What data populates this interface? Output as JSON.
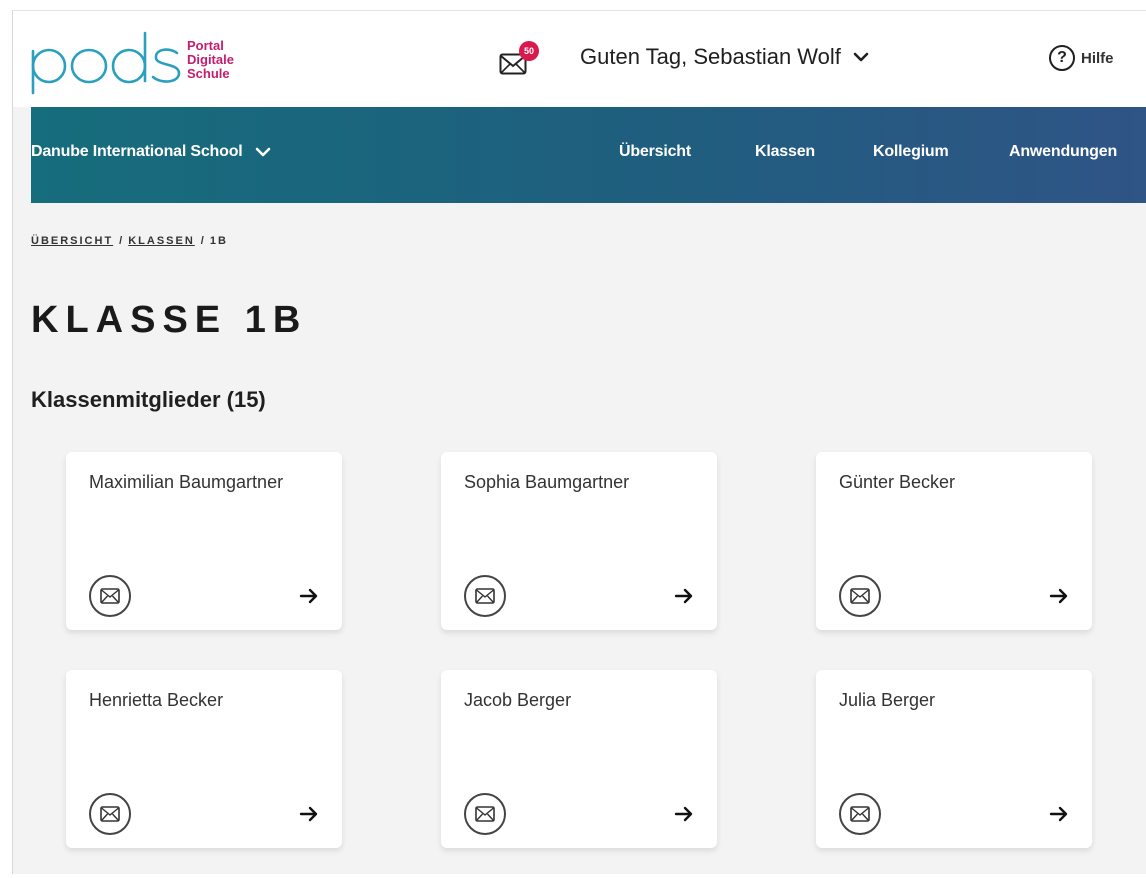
{
  "header": {
    "logo_word": "pods",
    "logo_sub": [
      "Portal",
      "Digitale",
      "Schule"
    ],
    "mail_badge": "50",
    "greeting": "Guten Tag, Sebastian Wolf",
    "help_label": "Hilfe",
    "help_symbol": "?"
  },
  "nav": {
    "school": "Danube International School",
    "links": [
      "Übersicht",
      "Klassen",
      "Kollegium",
      "Anwendungen"
    ]
  },
  "breadcrumb": {
    "items": [
      "ÜBERSICHT",
      "KLASSEN",
      "1B"
    ],
    "separator": "/"
  },
  "page": {
    "title": "KLASSE 1B",
    "members_heading": "Klassenmitglieder (15)"
  },
  "members": [
    "Maximilian Baumgartner",
    "Sophia Baumgartner",
    "Günter Becker",
    "Henrietta Becker",
    "Jacob Berger",
    "Julia Berger"
  ],
  "colors": {
    "nav_gradient_start": "#166d7c",
    "nav_gradient_end": "#2f5486",
    "brand_pink": "#c41d6f",
    "logo_teal": "#2aa0c0",
    "badge_red": "#d9184e"
  },
  "icons": {
    "mail": "mail-icon",
    "arrow": "arrow-right-icon",
    "chevron": "chevron-down-icon",
    "help": "help-circle-icon"
  }
}
